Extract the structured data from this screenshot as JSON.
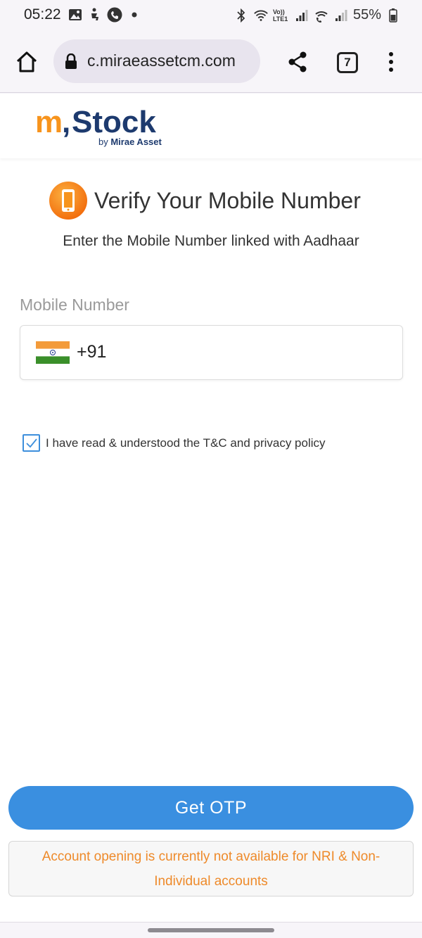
{
  "status_bar": {
    "time": "05:22",
    "battery": "55%",
    "network_label": "Vo)) LTE1"
  },
  "browser": {
    "url": "c.miraeassetcm.com",
    "tab_count": "7"
  },
  "brand": {
    "logo_primary": "m.Stock",
    "logo_secondary": "by Mirae Asset",
    "orange": "#f7941d",
    "navy": "#1d3a6e"
  },
  "form": {
    "title": "Verify Your Mobile Number",
    "subtitle": "Enter the Mobile Number linked with Aadhaar",
    "mobile_label": "Mobile Number",
    "country_code": "+91",
    "mobile_value": "",
    "tnc_text": "I have read & understood the T&C and privacy policy",
    "tnc_checked": true
  },
  "actions": {
    "get_otp_label": "Get OTP",
    "accent": "#3a8fe0"
  },
  "notice": {
    "text": "Account opening is currently not available for NRI & Non-Individual accounts",
    "color": "#ee8a2a"
  }
}
